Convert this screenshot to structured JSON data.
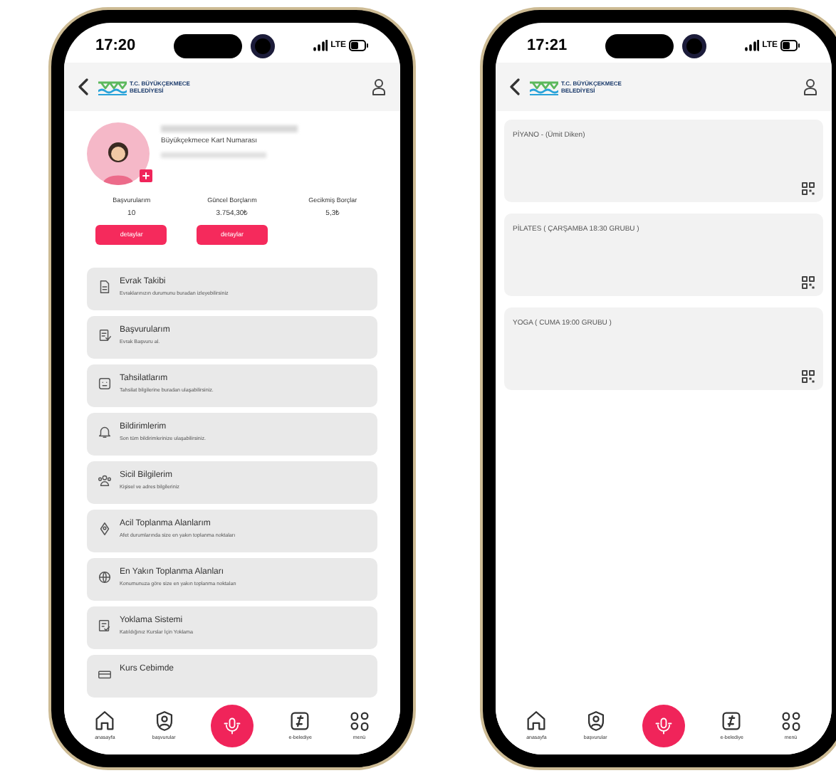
{
  "phones": [
    {
      "kind": "profile",
      "status_bar": {
        "time": "17:20",
        "network": "LTE"
      },
      "header": {
        "logo_lines": [
          "T.C. BÜYÜKÇEKMECE",
          "BELEDİYESİ"
        ]
      },
      "profile": {
        "card_label": "Büyükçekmece Kart Numarası"
      },
      "stats": [
        {
          "label": "Başvurularım",
          "value": "10",
          "button": "detaylar"
        },
        {
          "label": "Güncel Borçlarım",
          "value": "3.754,30₺",
          "button": "detaylar"
        },
        {
          "label": "Gecikmiş Borçlar",
          "value": "5,3₺"
        }
      ],
      "menu": [
        {
          "kind": "document",
          "title": "Evrak Takibi",
          "subtitle": "Evraklarınızın durumunu buradan izleyebilirsiniz"
        },
        {
          "kind": "application",
          "title": "Başvurularım",
          "subtitle": "Evrak Başvuru al."
        },
        {
          "kind": "payment",
          "title": "Tahsilatlarım",
          "subtitle": "Tahsilat bilgilerine buradan ulaşabilirsiniz."
        },
        {
          "kind": "bell",
          "title": "Bildirimlerim",
          "subtitle": "Son tüm bildirimlerinize ulaşabilirsiniz."
        },
        {
          "kind": "people",
          "title": "Sicil Bilgilerim",
          "subtitle": "Kişisel ve adres bilgileriniz"
        },
        {
          "kind": "pin",
          "title": "Acil Toplanma Alanlarım",
          "subtitle": "Afet durumlarında size en yakın toplanma noktaları"
        },
        {
          "kind": "globe",
          "title": "En Yakın Toplanma Alanları",
          "subtitle": "Konumunuza göre size en yakın toplanma noktaları"
        },
        {
          "kind": "attendance",
          "title": "Yoklama Sistemi",
          "subtitle": "Katıldığınız Kurslar İçin Yoklama"
        },
        {
          "kind": "course",
          "title": "Kurs Cebimde"
        }
      ],
      "tab_bar": [
        {
          "kind": "home",
          "label": "anasayfa"
        },
        {
          "kind": "applications",
          "label": "başvurular"
        },
        {
          "kind": "mic"
        },
        {
          "kind": "ebelediye",
          "label": "e-belediye"
        },
        {
          "kind": "menu",
          "label": "menü"
        }
      ]
    },
    {
      "kind": "courses",
      "status_bar": {
        "time": "17:21",
        "network": "LTE"
      },
      "header": {
        "logo_lines": [
          "T.C. BÜYÜKÇEKMECE",
          "BELEDİYESİ"
        ]
      },
      "courses": [
        {
          "title": "PİYANO - (Ümit Diken)"
        },
        {
          "title": "PİLATES ( ÇARŞAMBA 18:30 GRUBU )"
        },
        {
          "title": "YOGA ( CUMA 19:00 GRUBU )"
        }
      ],
      "tab_bar": [
        {
          "kind": "home",
          "label": "anasayfa"
        },
        {
          "kind": "applications",
          "label": "başvurular"
        },
        {
          "kind": "mic"
        },
        {
          "kind": "ebelediye",
          "label": "e-belediye"
        },
        {
          "kind": "menu",
          "label": "menü"
        }
      ]
    }
  ]
}
